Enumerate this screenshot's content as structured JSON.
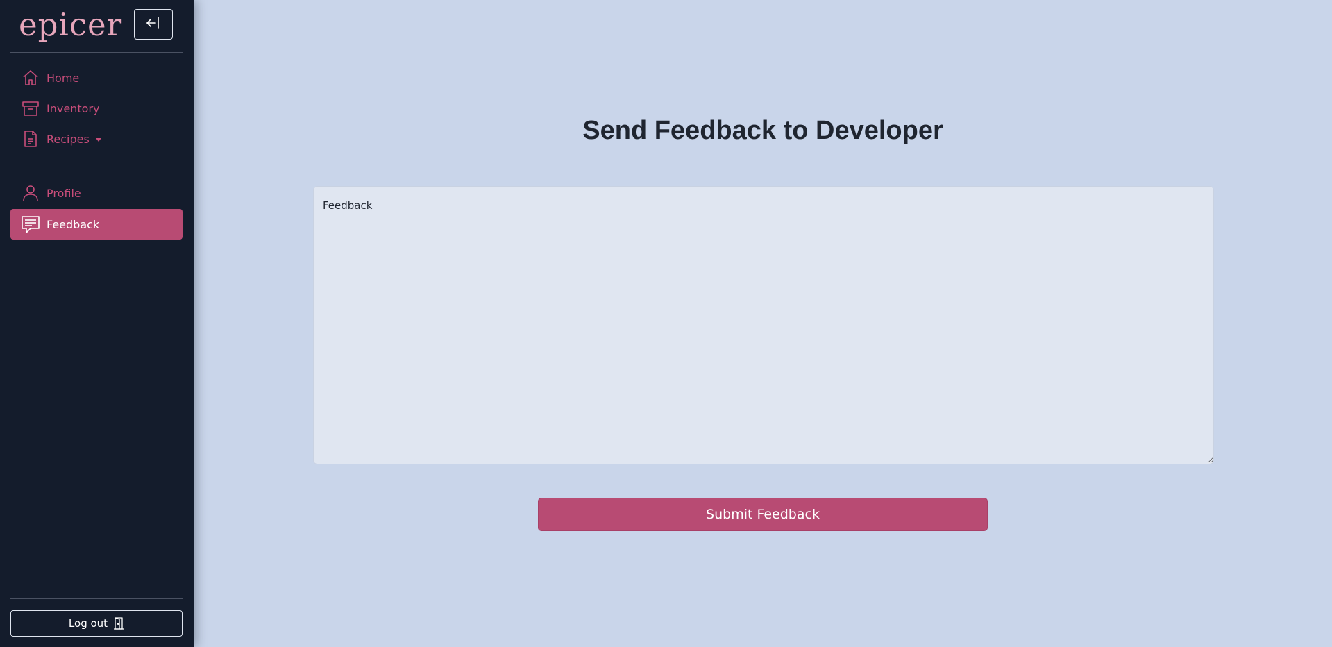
{
  "app": {
    "logo_text": "epicer",
    "brand_color": "#e7a6bb",
    "accent_color": "#b84b73",
    "sidebar_bg": "#141c2c",
    "page_bg": "#c9d5ea"
  },
  "sidebar": {
    "collapse_icon": "arrow-left-bar-icon",
    "primary_items": [
      {
        "label": "Home",
        "icon": "house-icon",
        "active": false
      },
      {
        "label": "Inventory",
        "icon": "archive-box-icon",
        "active": false
      },
      {
        "label": "Recipes",
        "icon": "document-icon",
        "active": false,
        "has_dropdown": true
      }
    ],
    "secondary_items": [
      {
        "label": "Profile",
        "icon": "person-icon",
        "active": false
      },
      {
        "label": "Feedback",
        "icon": "chat-bubble-icon",
        "active": true
      }
    ],
    "logout": {
      "label": "Log out",
      "icon": "door-icon"
    }
  },
  "main": {
    "title": "Send Feedback to Developer",
    "feedback": {
      "placeholder": "Feedback",
      "value": ""
    },
    "submit_label": "Submit Feedback"
  }
}
